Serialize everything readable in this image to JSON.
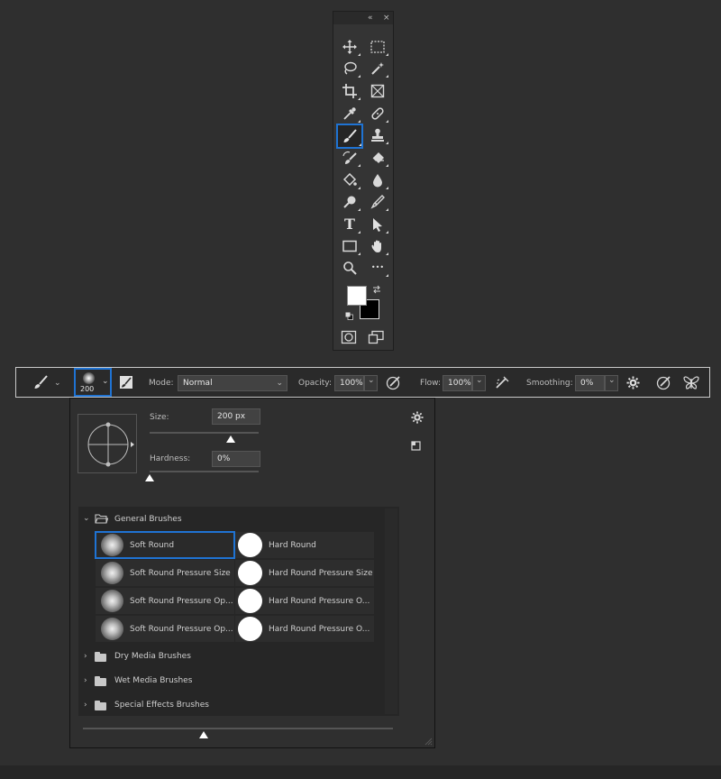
{
  "tools_panel": {
    "collapse_glyph": "«",
    "close_glyph": "×",
    "tools": [
      {
        "name": "move-tool",
        "icon": "move-icon",
        "glyph": "✥"
      },
      {
        "name": "marquee-tool",
        "icon": "rectangular-marquee-icon"
      },
      {
        "name": "lasso-tool",
        "icon": "lasso-icon"
      },
      {
        "name": "magic-wand-tool",
        "icon": "magic-wand-icon"
      },
      {
        "name": "crop-tool",
        "icon": "crop-icon"
      },
      {
        "name": "frame-tool",
        "icon": "frame-icon"
      },
      {
        "name": "eyedropper-tool",
        "icon": "eyedropper-icon"
      },
      {
        "name": "healing-tool",
        "icon": "bandage-icon"
      },
      {
        "name": "brush-tool",
        "icon": "brush-icon",
        "active": true
      },
      {
        "name": "stamp-tool",
        "icon": "clone-stamp-icon"
      },
      {
        "name": "history-brush-tool",
        "icon": "history-brush-icon"
      },
      {
        "name": "eraser-tool",
        "icon": "eraser-icon"
      },
      {
        "name": "paint-bucket-tool",
        "icon": "paint-bucket-icon"
      },
      {
        "name": "blur-tool",
        "icon": "blur-drop-icon"
      },
      {
        "name": "dodge-tool",
        "icon": "dodge-icon"
      },
      {
        "name": "pen-tool",
        "icon": "pen-icon"
      },
      {
        "name": "type-tool",
        "icon": "type-icon",
        "glyph": "T"
      },
      {
        "name": "path-select-tool",
        "icon": "arrow-icon"
      },
      {
        "name": "rectangle-tool",
        "icon": "rectangle-icon"
      },
      {
        "name": "hand-tool",
        "icon": "hand-icon"
      },
      {
        "name": "zoom-tool",
        "icon": "magnifier-icon"
      },
      {
        "name": "more-tools",
        "icon": "more-icon",
        "glyph": "•••"
      }
    ],
    "foreground_color": "#ffffff",
    "background_color": "#000000"
  },
  "options_bar": {
    "brush_size_preview": "200",
    "mode_label": "Mode:",
    "mode_value": "Normal",
    "opacity_label": "Opacity:",
    "opacity_value": "100%",
    "flow_label": "Flow:",
    "flow_value": "100%",
    "smoothing_label": "Smoothing:",
    "smoothing_value": "0%"
  },
  "brush_picker": {
    "size_label": "Size:",
    "size_value": "200 px",
    "size_fraction": 0.74,
    "hardness_label": "Hardness:",
    "hardness_value": "0%",
    "hardness_fraction": 0.0,
    "groups": [
      {
        "label": "General Brushes",
        "expanded": true
      },
      {
        "label": "Dry Media Brushes",
        "expanded": false
      },
      {
        "label": "Wet Media Brushes",
        "expanded": false
      },
      {
        "label": "Special Effects Brushes",
        "expanded": false
      }
    ],
    "brushes": [
      {
        "label": "Soft Round",
        "type": "soft",
        "selected": true
      },
      {
        "label": "Hard Round",
        "type": "hard"
      },
      {
        "label": "Soft Round Pressure Size",
        "type": "soft"
      },
      {
        "label": "Hard Round Pressure Size",
        "type": "hard"
      },
      {
        "label": "Soft Round Pressure Op...",
        "type": "soft"
      },
      {
        "label": "Hard Round Pressure O...",
        "type": "hard"
      },
      {
        "label": "Soft Round Pressure Op...",
        "type": "soft"
      },
      {
        "label": "Hard Round Pressure O...",
        "type": "hard"
      }
    ],
    "preview_scale_fraction": 0.39
  },
  "colors": {
    "accent": "#1f73d3",
    "panel": "#2f2f2f",
    "bar": "#2a2a2a"
  }
}
